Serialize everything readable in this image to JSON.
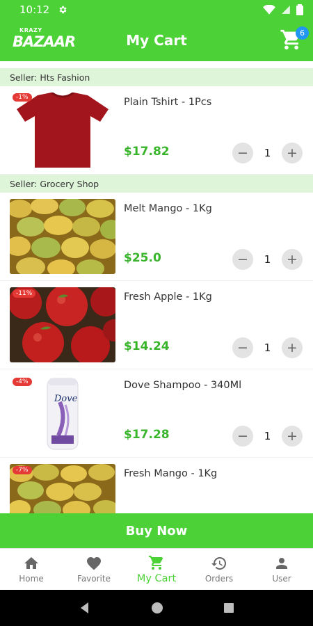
{
  "status_bar": {
    "time": "10:12"
  },
  "header": {
    "logo_top": "KRAZY",
    "logo_main": "BAZAAR",
    "title": "My Cart",
    "cart_count": "6"
  },
  "sellers": [
    {
      "label": "Seller: Hts Fashion",
      "items": [
        {
          "name": "Plain Tshirt - 1Pcs",
          "price": "$17.82",
          "qty": "1",
          "discount": "-1%"
        }
      ]
    },
    {
      "label": "Seller: Grocery Shop",
      "items": [
        {
          "name": "Melt Mango - 1Kg",
          "price": "$25.0",
          "qty": "1"
        },
        {
          "name": "Fresh Apple - 1Kg",
          "price": "$14.24",
          "qty": "1",
          "discount": "-11%"
        },
        {
          "name": "Dove Shampoo - 340Ml",
          "price": "$17.28",
          "qty": "1",
          "discount": "-4%"
        },
        {
          "name": "Fresh Mango - 1Kg",
          "discount": "-7%"
        }
      ]
    }
  ],
  "shampoo_brand": "Dove",
  "qty_controls": {
    "minus": "−",
    "plus": "+"
  },
  "buy_now_label": "Buy Now",
  "bottom_nav": [
    {
      "label": "Home",
      "icon": "home-icon"
    },
    {
      "label": "Favorite",
      "icon": "heart-icon"
    },
    {
      "label": "My Cart",
      "icon": "cart-icon",
      "active": true
    },
    {
      "label": "Orders",
      "icon": "history-icon"
    },
    {
      "label": "User",
      "icon": "user-icon"
    }
  ],
  "colors": {
    "primary": "#4cd137",
    "seller_bg": "#dff5da",
    "price": "#38b52a",
    "badge": "#2196f3",
    "discount": "#e53935"
  }
}
